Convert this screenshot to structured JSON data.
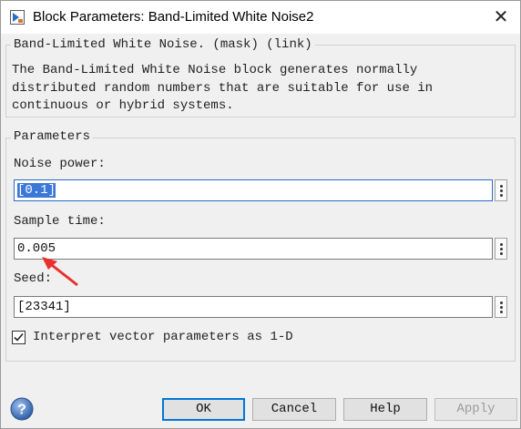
{
  "window": {
    "title": "Block Parameters: Band-Limited White Noise2"
  },
  "description_group": {
    "legend": "Band-Limited White Noise. (mask) (link)",
    "text": "The Band-Limited White Noise block generates normally distributed random numbers that are suitable for use in continuous or hybrid systems."
  },
  "parameters": {
    "legend": "Parameters",
    "noise_power": {
      "label": "Noise power:",
      "value": "[0.1]"
    },
    "sample_time": {
      "label": "Sample time:",
      "value": "0.005"
    },
    "seed": {
      "label": "Seed:",
      "value": "[23341]"
    },
    "interpret_vector": {
      "label": "Interpret vector parameters as 1-D",
      "checked": true
    }
  },
  "buttons": {
    "ok": "OK",
    "cancel": "Cancel",
    "help": "Help",
    "apply": "Apply"
  },
  "colors": {
    "selection": "#3b78d8",
    "annotation_arrow": "#e8312f",
    "focus_border": "#0078d7"
  }
}
